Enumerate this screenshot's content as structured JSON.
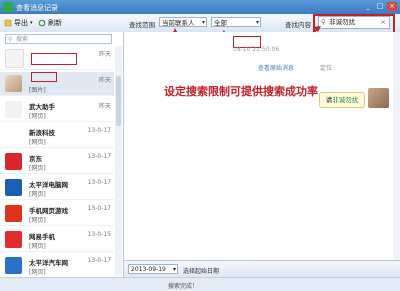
{
  "window": {
    "title": "查看消息记录"
  },
  "toolbar": {
    "export_label": "导出",
    "refresh_label": "刷新",
    "range_label": "查找范围",
    "range_value": "当前联系人",
    "scope_value": "全部",
    "content_label": "查找内容",
    "search_value": "非诚勿扰"
  },
  "left": {
    "search_placeholder": "搜索",
    "contacts": [
      {
        "name": "",
        "sub": "",
        "date": "昨天",
        "avatar": "blank",
        "selected": false
      },
      {
        "name": "",
        "sub": "[图片]",
        "date": "昨天",
        "avatar": "cat",
        "selected": true
      },
      {
        "name": "武大助手",
        "sub": "[网页]",
        "date": "昨天",
        "avatar": "wuda",
        "selected": false
      },
      {
        "name": "新浪科技",
        "sub": "[网页]",
        "date": "13-0-17",
        "avatar": "sina",
        "selected": false
      },
      {
        "name": "京东",
        "sub": "[网页]",
        "date": "13-0-17",
        "avatar": "jd",
        "selected": false
      },
      {
        "name": "太平洋电脑网",
        "sub": "[网页]",
        "date": "13-0-17",
        "avatar": "pconline",
        "selected": false
      },
      {
        "name": "手机网页游戏",
        "sub": "[网页]",
        "date": "13-0-17",
        "avatar": "game",
        "selected": false
      },
      {
        "name": "网易手机",
        "sub": "[网页]",
        "date": "13-0-15",
        "avatar": "netease",
        "selected": false
      },
      {
        "name": "太平洋汽车网",
        "sub": "[网页]",
        "date": "13-0-17",
        "avatar": "pcauto",
        "selected": false
      }
    ]
  },
  "right": {
    "timestamp": "08-10 21:50:06",
    "msg_link": "查看原始消息",
    "msg_time": "定位",
    "annotation": "设定搜索限制可提供搜索成功率",
    "bubble_pre": "请",
    "bubble_hl": "非诚勿扰"
  },
  "bottom": {
    "date_value": "2013-09-19",
    "date_label": "选择起始日期"
  },
  "status": {
    "text": "搜索完成！"
  },
  "colors": {
    "highlight": "#c2202a",
    "titlebar": "#3b7cc3"
  }
}
